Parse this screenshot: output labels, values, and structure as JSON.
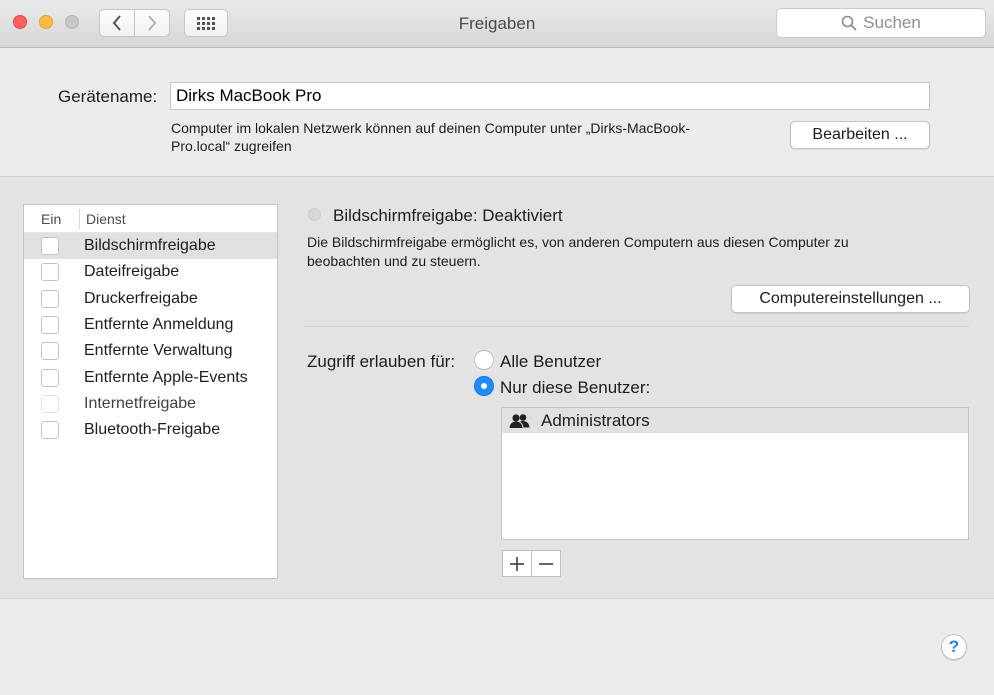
{
  "window": {
    "title": "Freigaben"
  },
  "toolbar": {
    "search_placeholder": "Suchen"
  },
  "device": {
    "label": "Gerätename:",
    "name_value": "Dirks MacBook Pro",
    "info_line1": "Computer im lokalen Netzwerk können auf deinen Computer unter „Dirks-MacBook-",
    "info_line2": "Pro.local“ zugreifen",
    "edit_label": "Bearbeiten ..."
  },
  "services": {
    "col_on": "Ein",
    "col_service": "Dienst",
    "items": [
      {
        "label": "Bildschirmfreigabe",
        "checked": false,
        "selected": true
      },
      {
        "label": "Dateifreigabe",
        "checked": false
      },
      {
        "label": "Druckerfreigabe",
        "checked": false
      },
      {
        "label": "Entfernte Anmeldung",
        "checked": false
      },
      {
        "label": "Entfernte Verwaltung",
        "checked": false
      },
      {
        "label": "Entfernte Apple-Events",
        "checked": false
      },
      {
        "label": "Internetfreigabe",
        "checked": false,
        "disabled": true
      },
      {
        "label": "Bluetooth-Freigabe",
        "checked": false
      }
    ]
  },
  "detail": {
    "status_title": "Bildschirmfreigabe: Deaktiviert",
    "description_line1": "Die Bildschirmfreigabe ermöglicht es, von anderen Computern aus diesen Computer zu",
    "description_line2": "beobachten und zu steuern.",
    "computer_settings_label": "Computereinstellungen ...",
    "access_label": "Zugriff erlauben für:",
    "radio_all": "Alle Benutzer",
    "radio_only": "Nur diese Benutzer:",
    "selected_radio": "only",
    "users": [
      "Administrators"
    ],
    "add_symbol": "+",
    "remove_symbol": "—"
  },
  "help_label": "?",
  "colors": {
    "accent": "#1e8bff",
    "close": "#fc605c",
    "minimize": "#fdbc40"
  }
}
